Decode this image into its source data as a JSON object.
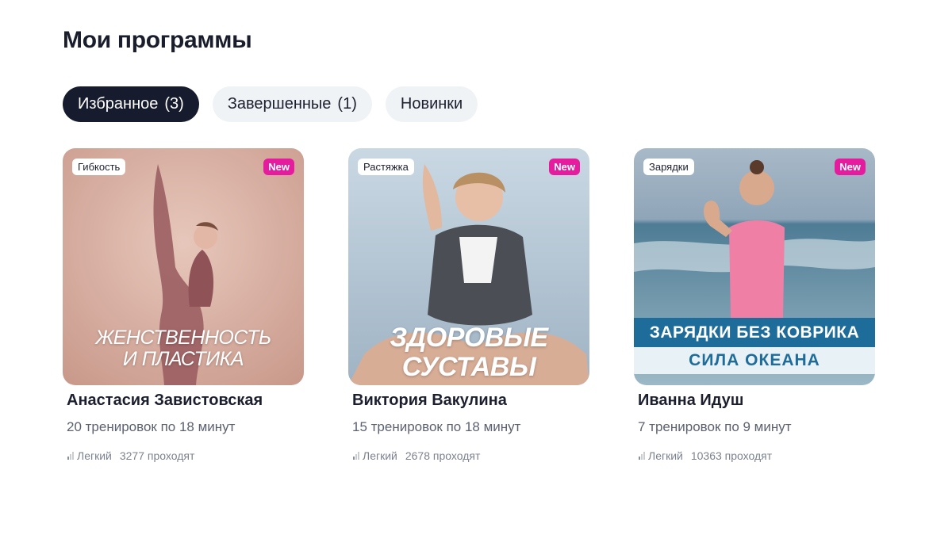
{
  "page": {
    "title": "Мои программы"
  },
  "tabs": [
    {
      "label": "Избранное",
      "count": "(3)"
    },
    {
      "label": "Завершенные",
      "count": "(1)"
    },
    {
      "label": "Новинки",
      "count": ""
    }
  ],
  "programs": [
    {
      "category": "Гибкость",
      "badge": "New",
      "cover_title_line1": "ЖЕНСТВЕННОСТЬ",
      "cover_title_line2": "И ПЛАСТИКА",
      "author": "Анастасия Завистовская",
      "workouts": "20 тренировок по 18 минут",
      "level": "Легкий",
      "participants": "3277 проходят",
      "palette": {
        "bg": "#dcb3a4"
      }
    },
    {
      "category": "Растяжка",
      "badge": "New",
      "cover_title_line1": "ЗДОРОВЫЕ",
      "cover_title_line2": "СУСТАВЫ",
      "author": "Виктория Вакулина",
      "workouts": "15 тренировок по 18 минут",
      "level": "Легкий",
      "participants": "2678 проходят",
      "palette": {
        "bg": "#b4c7d6"
      }
    },
    {
      "category": "Зарядки",
      "badge": "New",
      "cover_title_line1": "ЗАРЯДКИ БЕЗ КОВРИКА",
      "cover_title_line2": "СИЛА ОКЕАНА",
      "author": "Иванна Идуш",
      "workouts": "7 тренировок по 9 минут",
      "level": "Легкий",
      "participants": "10363 проходят",
      "palette": {
        "bg": "#8fa9be"
      }
    }
  ]
}
